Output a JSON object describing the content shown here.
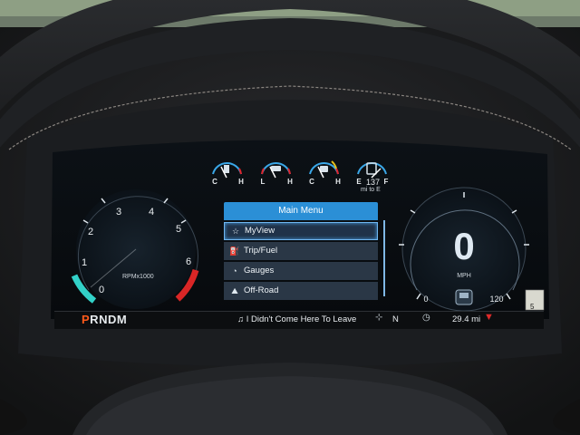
{
  "rpm_gauge": {
    "tick_labels": [
      "0",
      "1",
      "2",
      "3",
      "4",
      "5",
      "6"
    ],
    "unit": "RPMx1000"
  },
  "top_gauges": [
    {
      "name": "coolant-temp",
      "left": "C",
      "right": "H"
    },
    {
      "name": "oil-level",
      "left": "L",
      "right": "H"
    },
    {
      "name": "trans-temp",
      "left": "C",
      "right": "H"
    },
    {
      "name": "fuel",
      "left": "E",
      "right": "F"
    }
  ],
  "fuel": {
    "range_value": "137",
    "range_unit": "mi to E"
  },
  "menu": {
    "title": "Main Menu",
    "items": [
      {
        "label": "MyView",
        "icon": "star-icon",
        "selected": true
      },
      {
        "label": "Trip/Fuel",
        "icon": "fuel-pump-icon",
        "selected": false
      },
      {
        "label": "Gauges",
        "icon": "gauge-icon",
        "selected": false
      },
      {
        "label": "Off-Road",
        "icon": "offroad-icon",
        "selected": false
      }
    ]
  },
  "speedometer": {
    "speed": "0",
    "unit": "MPH",
    "min_label": "0",
    "max_label": "120"
  },
  "status_bar": {
    "gear_letters": [
      "P",
      "R",
      "N",
      "D",
      "M"
    ],
    "active_gear": "P",
    "song_title": "I Didn't Come Here To Leave",
    "drive_mode": "N",
    "trip_distance": "29.4 mi"
  },
  "side_badge": "5",
  "colors": {
    "accent_blue": "#2b8fd6",
    "rpm_low_cyan": "#32d1c8",
    "rpm_redline": "#e02a2a",
    "active_gear_orange": "#ff5a1a"
  }
}
